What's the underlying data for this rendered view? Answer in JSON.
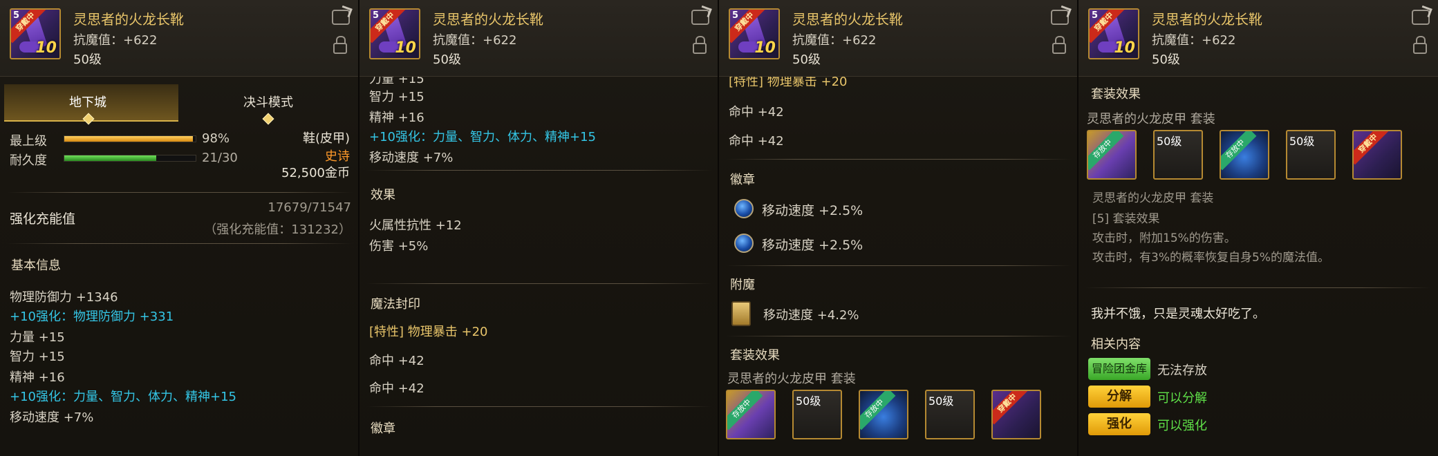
{
  "item": {
    "name": "灵思者的火龙长靴",
    "magic_resist": "抗魔值：+622",
    "level": "50级",
    "wear_badge": "穿戴中",
    "slot_number": "5",
    "enhance_level": "10"
  },
  "panel1": {
    "tabs": [
      "地下城",
      "决斗模式"
    ],
    "max_level_label": "最上级",
    "max_level_value": "98%",
    "max_level_fraction": 0.98,
    "durability_label": "耐久度",
    "durability_value": "21/30",
    "durability_fraction": 0.7,
    "slot_type": "鞋(皮甲)",
    "rarity": "史诗",
    "price": "52,500金币",
    "charge_label": "强化充能值",
    "charge_value": "17679/71547",
    "charge_sub": "（强化充能值：131232）",
    "basic_info_title": "基本信息",
    "stats": [
      "物理防御力 +1346",
      "+10强化：物理防御力 +331",
      "力量 +15",
      "智力 +15",
      "精神 +16",
      "+10强化：力量、智力、体力、精神+15",
      "移动速度 +7%"
    ]
  },
  "panel2": {
    "lines": [
      "力量 +15",
      "智力 +15",
      "精神 +16",
      "+10强化：力量、智力、体力、精神+15",
      "移动速度 +7%"
    ],
    "effect_title": "效果",
    "effects": [
      "火属性抗性 +12",
      "伤害 +5%"
    ],
    "seal_title": "魔法封印",
    "seal_lines": [
      "[特性] 物理暴击 +20",
      "命中 +42",
      "命中 +42"
    ],
    "emblem_title": "徽章"
  },
  "panel3": {
    "top_line": "[特性] 物理暴击 +20",
    "hit_lines": [
      "命中 +42",
      "命中 +42"
    ],
    "emblem_title": "徽章",
    "emblems": [
      "移动速度 +2.5%",
      "移动速度 +2.5%"
    ],
    "enchant_title": "附魔",
    "enchant": "移动速度 +4.2%",
    "set_title": "套装效果",
    "set_name": "灵思者的火龙皮甲 套装"
  },
  "set_slots": [
    {
      "type": "armor",
      "badge": "存放中",
      "level": ""
    },
    {
      "type": "empty",
      "badge": "",
      "level": "50级"
    },
    {
      "type": "glove",
      "badge": "存放中",
      "level": ""
    },
    {
      "type": "empty",
      "badge": "",
      "level": "50级"
    },
    {
      "type": "boots",
      "badge": "穿戴中",
      "level": ""
    }
  ],
  "panel4": {
    "set_title": "套装效果",
    "set_name": "灵思者的火龙皮甲 套装",
    "set_name2": "灵思者的火龙皮甲 套装",
    "set_bonus_title": "[5] 套装效果",
    "set_bonus_lines": [
      "攻击时，附加15%的伤害。",
      "攻击时，有3%的概率恢复自身5%的魔法值。"
    ],
    "flavor": "我并不饿，只是灵魂太好吃了。",
    "related_title": "相关内容",
    "actions": [
      {
        "button": "冒险团金库",
        "status": "无法存放"
      },
      {
        "button": "分解",
        "status": "可以分解"
      },
      {
        "button": "强化",
        "status": "可以强化"
      }
    ]
  },
  "colors": {
    "gold": "#e8c56a",
    "cyan": "#34c6e6",
    "green": "#5fe048",
    "orange": "#ff9a2a"
  }
}
